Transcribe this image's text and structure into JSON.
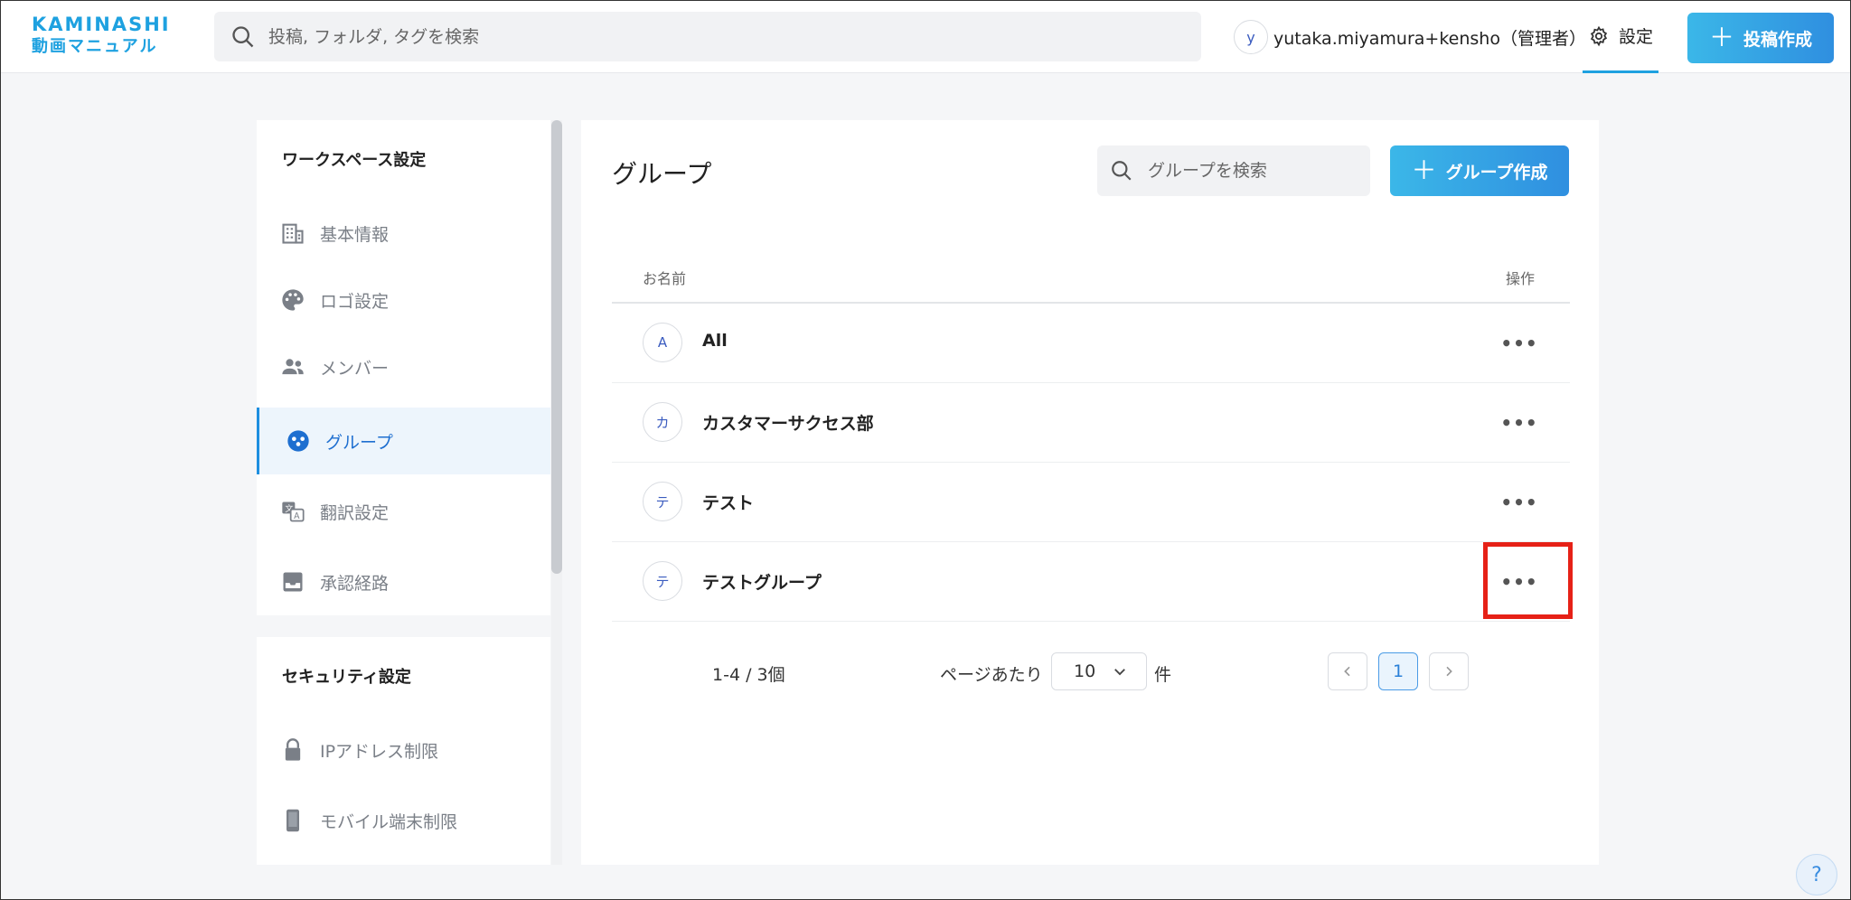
{
  "header": {
    "logo_top": "KAMINASHI",
    "logo_bottom": "動画マニュアル",
    "search_placeholder": "投稿, フォルダ, タグを検索",
    "user_initial": "y",
    "user_name": "yutaka.miyamura+kensho（管理者）",
    "settings_label": "設定",
    "post_button_label": "投稿作成",
    "accent_color": "#1ea1e0"
  },
  "sidebar": {
    "workspace_title": "ワークスペース設定",
    "workspace_items": [
      {
        "label": "基本情報",
        "icon": "building-icon"
      },
      {
        "label": "ロゴ設定",
        "icon": "palette-icon"
      },
      {
        "label": "メンバー",
        "icon": "members-icon"
      },
      {
        "label": "グループ",
        "icon": "group-icon",
        "active": true
      },
      {
        "label": "翻訳設定",
        "icon": "translate-icon"
      },
      {
        "label": "承認経路",
        "icon": "inbox-icon"
      }
    ],
    "security_title": "セキュリティ設定",
    "security_items": [
      {
        "label": "IPアドレス制限",
        "icon": "lock-icon"
      },
      {
        "label": "モバイル端末制限",
        "icon": "phone-icon"
      }
    ]
  },
  "main": {
    "title": "グループ",
    "search_placeholder": "グループを検索",
    "create_button_label": "グループ作成",
    "columns": {
      "name": "お名前",
      "actions": "操作"
    },
    "rows": [
      {
        "initial": "A",
        "name": "All"
      },
      {
        "initial": "カ",
        "name": "カスタマーサクセス部"
      },
      {
        "initial": "テ",
        "name": "テスト"
      },
      {
        "initial": "テ",
        "name": "テストグループ"
      }
    ],
    "pagination": {
      "count_text": "1-4 / 3個",
      "per_page_label": "ページあたり",
      "per_page_value": "10",
      "per_page_unit": "件",
      "current_page": "1"
    }
  },
  "help_label": "?"
}
